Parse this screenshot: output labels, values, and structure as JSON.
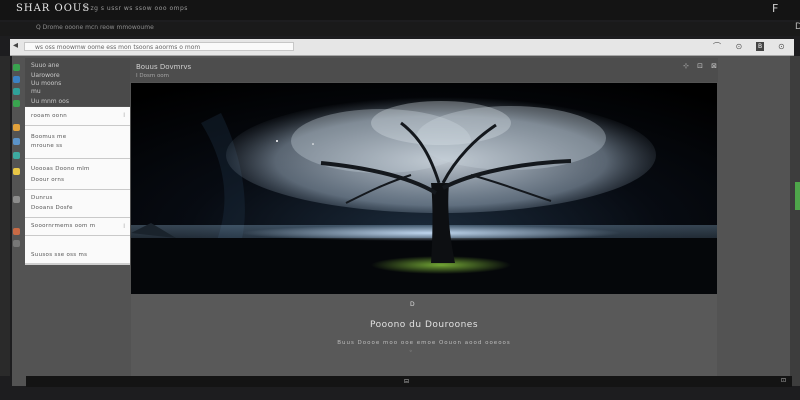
{
  "app": {
    "title": "SHAR OOUS",
    "menu": "P   zg  s  ussr ws  ssow  ooo  omps",
    "top_right_icon": "F",
    "subbar_text": "Q  Drome ooone  mcn  reow  mmowoume",
    "subbar_icon": "D"
  },
  "address_bar": {
    "value": "ws  oss  moowmw  oome  ess  mon  tsoons  aoorms  o  mom",
    "back_icon": "◂",
    "icons": "⌒ ⊙ ⊡ ⊙",
    "badge": "B"
  },
  "sidebar": {
    "header_lines": [
      "Suuo ane",
      "Uarowore",
      "Uu  moons",
      "mu",
      "Uu  mnm oos"
    ],
    "groups": [
      {
        "items": [
          "rooam  oonn"
        ],
        "mark": "I"
      },
      {
        "items": [
          "Boomus me",
          "mroune ss"
        ],
        "mark": ""
      },
      {
        "items": [
          "Uoooas  Doono  mlm",
          "Doour  orns"
        ],
        "mark": ""
      },
      {
        "items": [
          "Dunrus",
          "Dooans  Dosfe"
        ],
        "mark": ""
      },
      {
        "items": [
          "Sooornrmems  oom  m"
        ],
        "mark": "I"
      },
      {
        "items": [
          "Suusos sse  oss  ms"
        ],
        "mark": ""
      }
    ]
  },
  "main": {
    "title": "Bouus  Dovmrvs",
    "subtitle": "I  Dosm  oom",
    "controls": "⊹ ⊡ ⊠",
    "caption_mark": "D",
    "caption_title": "Pooono  du  Douroones",
    "caption_sub": "Buus  Doooe  moo  ooe  emoe  Oouon  aood  ooeoos",
    "caption_dot": "◦"
  },
  "bottom": {
    "center": "⊟",
    "right": "⊡"
  },
  "colors": {
    "accent_green": "#4ea64a",
    "chrome_dark": "#141414",
    "window_gray": "#535353",
    "sidebar_bg": "#fafafa"
  }
}
